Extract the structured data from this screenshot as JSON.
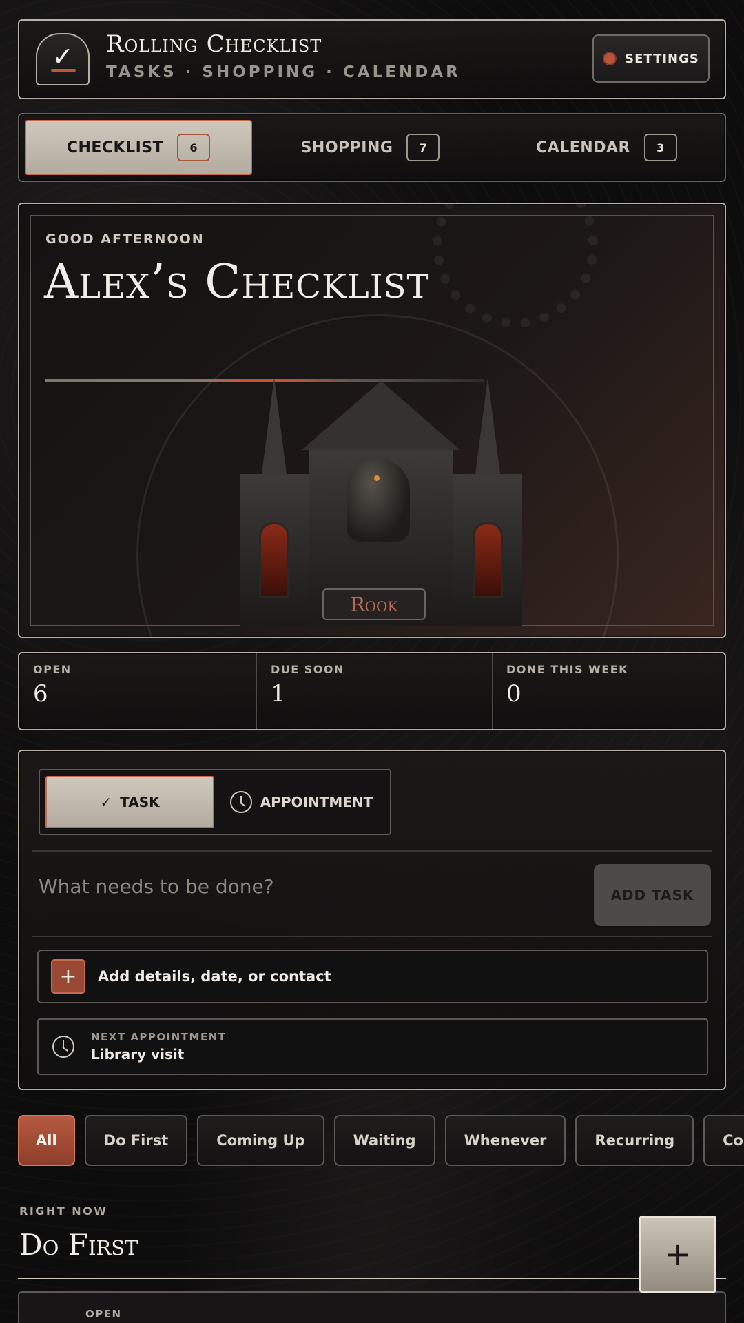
{
  "header": {
    "title": "Rolling Checklist",
    "subtitle": "TASKS · SHOPPING · CALENDAR",
    "settings_label": "SETTINGS",
    "logo_icon": "checkmark-icon"
  },
  "tabs": [
    {
      "label": "CHECKLIST",
      "count": "6",
      "active": true
    },
    {
      "label": "SHOPPING",
      "count": "7",
      "active": false
    },
    {
      "label": "CALENDAR",
      "count": "3",
      "active": false
    }
  ],
  "hero": {
    "greeting": "GOOD AFTERNOON",
    "title": "Alex’s Checklist",
    "illustration_plaque": "Rook"
  },
  "stats": [
    {
      "label": "OPEN",
      "value": "6"
    },
    {
      "label": "DUE SOON",
      "value": "1"
    },
    {
      "label": "DONE THIS WEEK",
      "value": "0"
    }
  ],
  "composer": {
    "mode_task": "TASK",
    "mode_task_icon": "✓",
    "mode_appointment": "APPOINTMENT",
    "input_placeholder": "What needs to be done?",
    "add_button": "ADD TASK",
    "details_label": "Add details, date, or contact",
    "next_appointment_label": "NEXT APPOINTMENT",
    "next_appointment_value": "Library visit"
  },
  "filters": [
    "All",
    "Do First",
    "Coming Up",
    "Waiting",
    "Whenever",
    "Recurring",
    "Completed"
  ],
  "active_filter": "All",
  "section": {
    "eyebrow": "RIGHT NOW",
    "title": "Do First",
    "card_label": "OPEN"
  },
  "colors": {
    "accent": "#c4553b",
    "background": "#0d0c0c",
    "frame": "#b9b1a6"
  }
}
